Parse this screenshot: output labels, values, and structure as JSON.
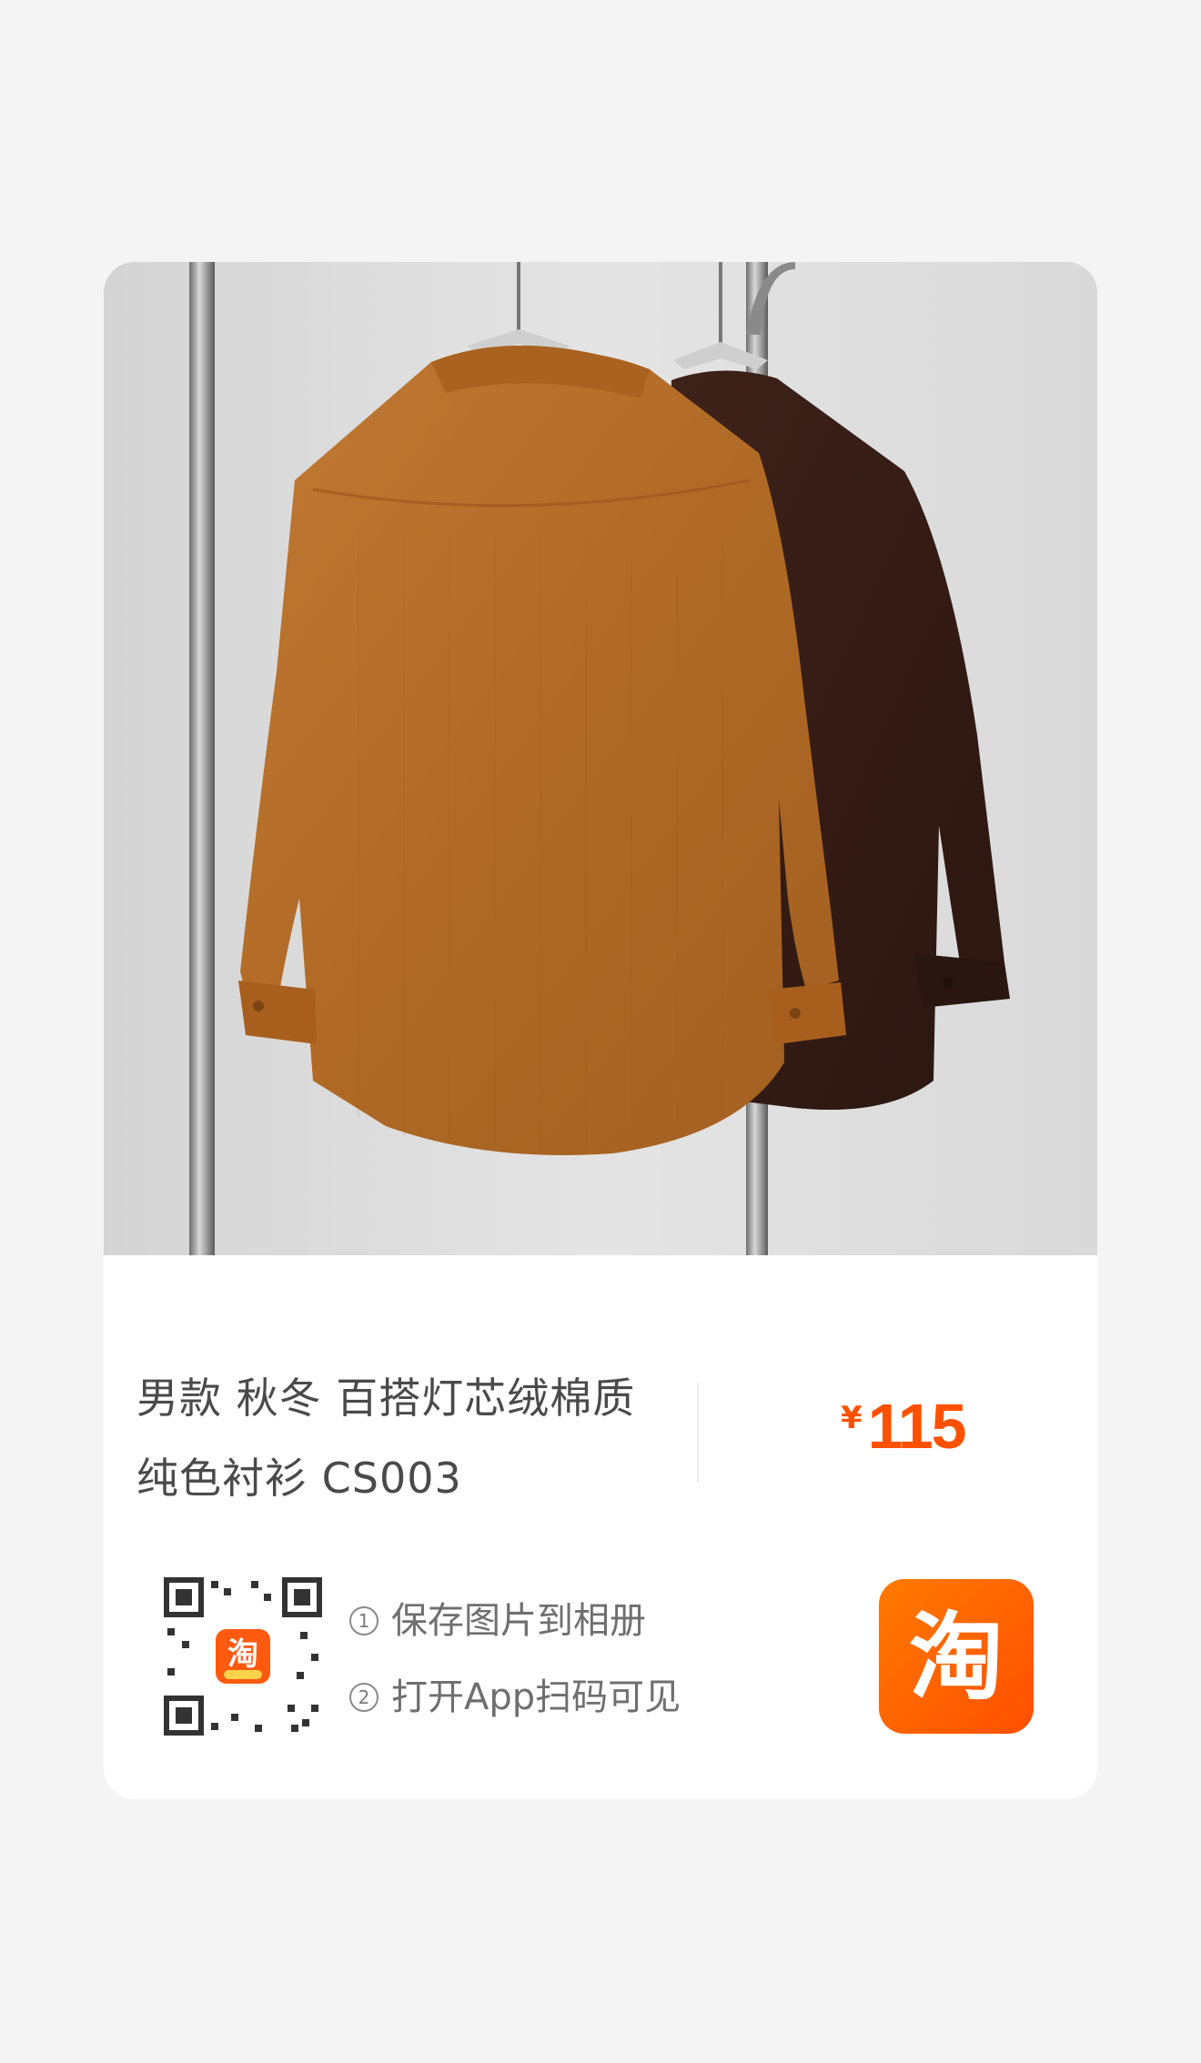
{
  "product": {
    "title_line1": "男款 秋冬 百搭灯芯绒棉质",
    "title_line2": "纯色衬衫 CS003",
    "currency_symbol": "¥",
    "price": "115"
  },
  "share": {
    "step1_num": "1",
    "step1_text": "保存图片到相册",
    "step2_num": "2",
    "step2_text": "打开App扫码可见"
  },
  "colors": {
    "accent": "#ff5000",
    "shirt_left": "#b8702c",
    "shirt_right": "#3a2019"
  },
  "icons": {
    "qr": "qr-code-icon",
    "app": "taobao-logo-icon"
  }
}
